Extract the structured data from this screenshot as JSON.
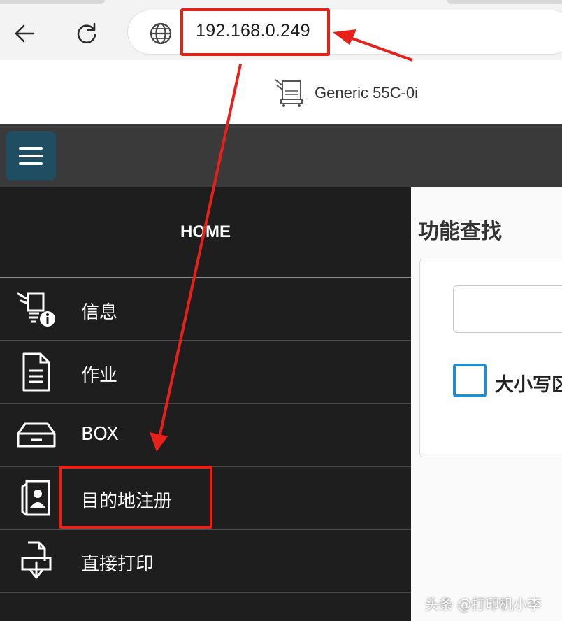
{
  "browser": {
    "url": "192.168.0.249",
    "back_icon": "back-arrow-icon",
    "reload_icon": "reload-icon",
    "site_icon": "globe-icon"
  },
  "device": {
    "name": "Generic 55C-0i",
    "icon": "printer-icon"
  },
  "sidebar": {
    "home_label": "HOME",
    "items": [
      {
        "label": "信息",
        "icon": "printer-info-icon"
      },
      {
        "label": "作业",
        "icon": "document-icon"
      },
      {
        "label": "BOX",
        "icon": "box-tray-icon"
      },
      {
        "label": "目的地注册",
        "icon": "address-book-icon"
      },
      {
        "label": "直接打印",
        "icon": "direct-print-icon"
      }
    ]
  },
  "search_panel": {
    "title": "功能查找",
    "case_label": "大小写区"
  },
  "watermark": "头条 @打印机小李",
  "colors": {
    "annotation_red": "#e8201a",
    "menu_button": "#1f4e63",
    "checkbox_border": "#1f8fc9",
    "sidebar_bg": "#1e1e1e"
  }
}
